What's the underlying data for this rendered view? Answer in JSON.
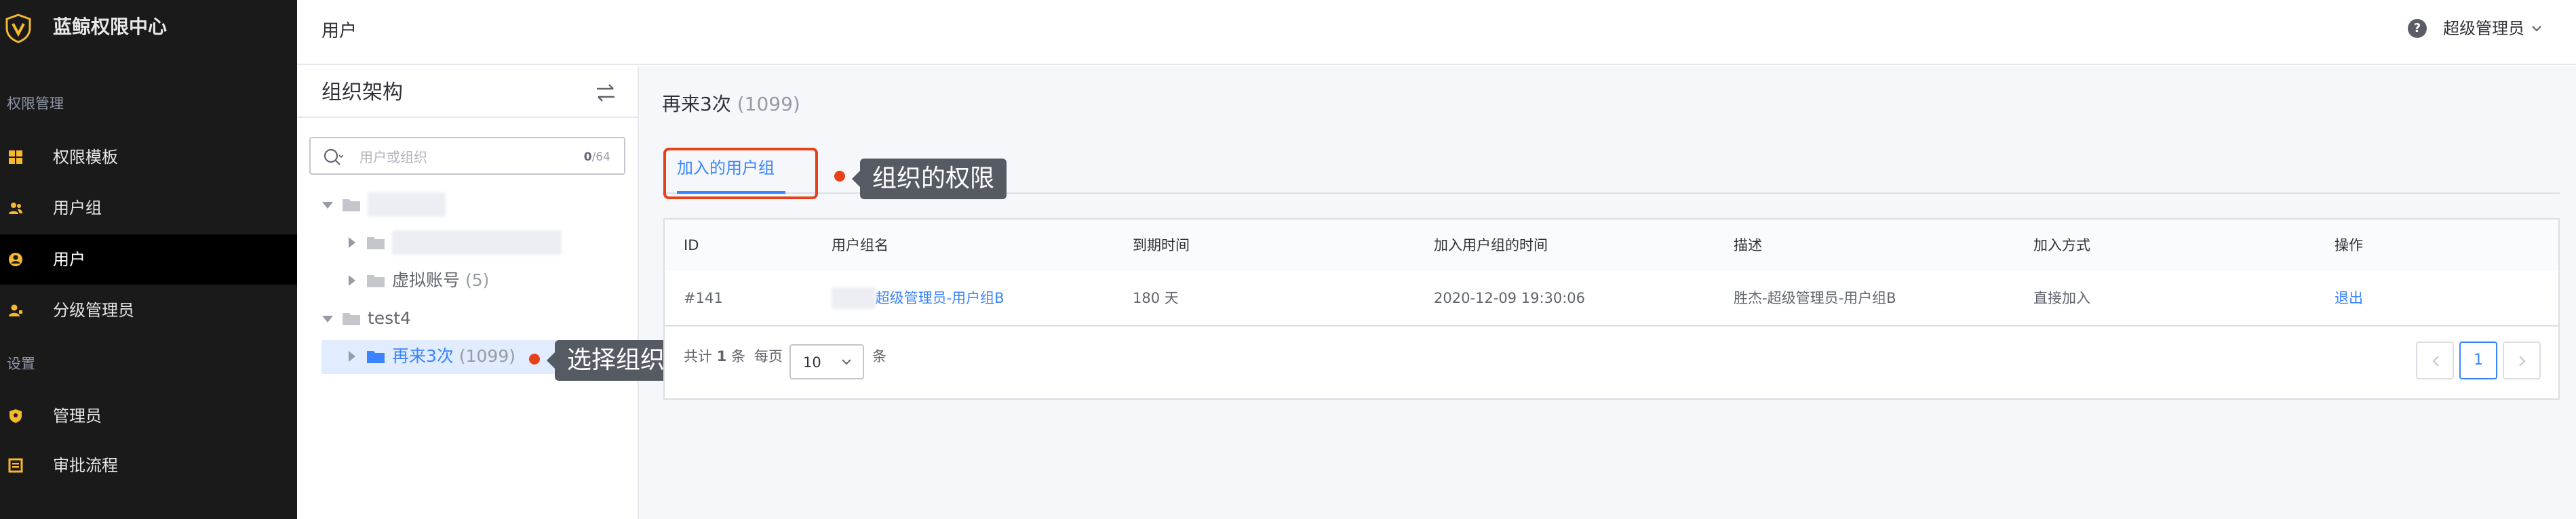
{
  "app": {
    "title": "蓝鲸权限中心"
  },
  "sidebar": {
    "groups": [
      {
        "title": "权限管理"
      },
      {
        "title": "设置"
      }
    ],
    "items": [
      {
        "label": "权限模板",
        "icon": "template-grid-icon"
      },
      {
        "label": "用户组",
        "icon": "user-group-icon"
      },
      {
        "label": "用户",
        "icon": "user-icon",
        "active": true
      },
      {
        "label": "分级管理员",
        "icon": "grade-admin-icon"
      },
      {
        "label": "管理员",
        "icon": "admin-shield-icon"
      },
      {
        "label": "审批流程",
        "icon": "approval-flow-icon"
      }
    ]
  },
  "header": {
    "breadcrumb": "用户",
    "help": "?",
    "user": "超级管理员"
  },
  "org_panel": {
    "title": "组织架构",
    "search": {
      "placeholder": "用户或组织",
      "count_current": "0",
      "count_total": "/64"
    },
    "tree": [
      {
        "label": "",
        "count": ""
      },
      {
        "label": "",
        "count": ""
      },
      {
        "label": "虚拟账号",
        "count": "(5)"
      },
      {
        "label": "test4",
        "count": ""
      },
      {
        "label": "再来3次",
        "count": "(1099)"
      }
    ]
  },
  "main": {
    "title": "再来3次",
    "count": "(1099)",
    "tab": "加入的用户组",
    "table": {
      "headers": [
        "ID",
        "用户组名",
        "到期时间",
        "加入用户组的时间",
        "描述",
        "加入方式",
        "操作"
      ],
      "rows": [
        [
          "#141",
          "超级管理员-用户组B",
          "180 天",
          "2020-12-09 19:30:06",
          "胜杰-超级管理员-用户组B",
          "直接加入",
          "退出"
        ]
      ]
    },
    "pagination": {
      "total_prefix": "共计",
      "total": "1",
      "total_suffix": "条",
      "per_page_label": "每页",
      "per_page": "10",
      "per_page_suffix": "条",
      "current_page": "1"
    }
  },
  "annotations": [
    {
      "text": "组织的权限"
    },
    {
      "text": "选择组织"
    }
  ],
  "colors": {
    "accent": "#3a84ff",
    "highlight": "#e64119",
    "sidebar_bg": "#1a1a1a",
    "brand_icon": "#f5b82e"
  }
}
